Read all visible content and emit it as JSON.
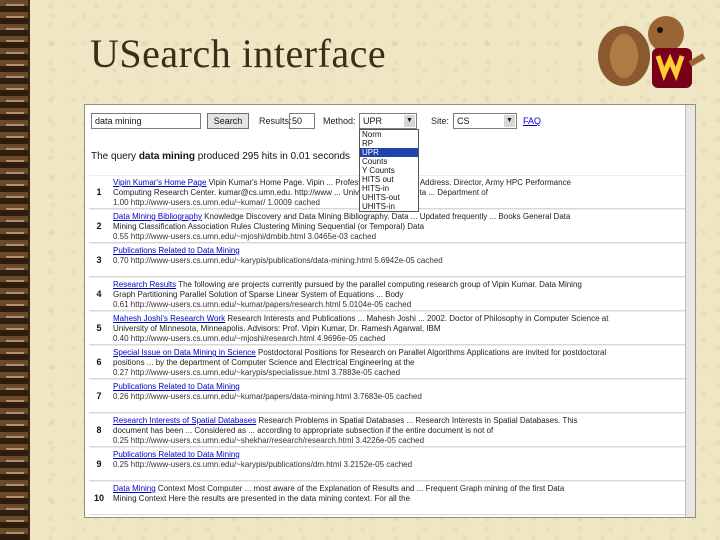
{
  "slide": {
    "title": "USearch interface"
  },
  "search": {
    "query": "data mining",
    "button": "Search",
    "results_label": "Results:",
    "results_value": "50",
    "method_label": "Method:",
    "method_value": "UPR",
    "method_options": [
      "Norm",
      "RP",
      "UPR",
      "Counts",
      "Y Counts",
      "HITS out",
      "HITS-in",
      "UHITS-out",
      "UHITS-in"
    ],
    "site_label": "Site:",
    "site_value": "CS",
    "faq": "FAQ"
  },
  "summary": {
    "prefix": "The query",
    "query": "data mining",
    "suffix": "produced 295 hits in 0.01 seconds"
  },
  "results": [
    {
      "num": "1",
      "title": "Vipin Kumar's Home Page",
      "snippet": "Vipin Kumar's Home Page. Vipin ... Professor ... Affiliation's Address. Director, Army HPC Performance",
      "snippet2": "Computing Research Center. kumar@cs.umn.edu. http://www ... University of Minnesota ... Department of",
      "meta": "1.00 http://www-users.cs.umn.edu/~kumar/ 1.0009 cached"
    },
    {
      "num": "2",
      "title": "Data Mining Bibliography",
      "snippet": "Knowledge Discovery and Data Mining Bibliography. Data ... Updated frequently ... Books General Data",
      "snippet2": "Mining Classification Association Rules Clustering Mining Sequential (or Temporal) Data",
      "meta": "0.55 http://www-users.cs.umn.edu/~mjoshi/dmbib.html 3.0465e-03 cached"
    },
    {
      "num": "3",
      "title": "Publications Related to Data Mining",
      "snippet": "",
      "snippet2": "",
      "meta": "0.70 http://www-users.cs.umn.edu/~karypis/publications/data-mining.html 5.6942e-05 cached"
    },
    {
      "num": "4",
      "title": "Research Results",
      "snippet": "The following are projects currently pursued by the parallel computing research group of Vipin Kumar. Data Mining",
      "snippet2": "Graph Partitioning Parallel Solution of Sparse Linear System of Equations ... Body",
      "meta": "0.61 http://www-users.cs.umn.edu/~kumar/papers/research.html 5.0104e-05 cached"
    },
    {
      "num": "5",
      "title": "Mahesh Joshi's Research Work",
      "snippet": "Research Interests and Publications ... Mahesh Joshi ... 2002. Doctor of Philosophy in Computer Science at",
      "snippet2": "University of Minnesota, Minneapolis. Advisors: Prof. Vipin Kumar, Dr. Ramesh Agarwal, IBM",
      "meta": "0.40 http://www-users.cs.umn.edu/~mjoshi/research.html 4.9696e-05 cached"
    },
    {
      "num": "6",
      "title": "Special Issue on Data Mining in Science",
      "snippet": "Postdoctoral Positions for Research on Parallel Algorithms Applications are invited for postdoctoral",
      "snippet2": "positions ... by the department of Computer Science and Electrical Engineering at the",
      "meta": "0.27 http://www-users.cs.umn.edu/~karypis/specialissue.html 3.7883e-05 cached"
    },
    {
      "num": "7",
      "title": "Publications Related to Data Mining",
      "snippet": "",
      "snippet2": "",
      "meta": "0.26 http://www-users.cs.umn.edu/~kumar/papers/data-mining.html 3.7683e-05 cached"
    },
    {
      "num": "8",
      "title": "Research Interests of Spatial Databases",
      "snippet": "Research Problems in Spatial Databases ... Research Interests in Spatial Databases. This",
      "snippet2": "document has been ... Considered as ... according to appropriate subsection if the entire document is not of",
      "meta": "0.25 http://www-users.cs.umn.edu/~shekhar/research/research.html 3.4226e-05 cached"
    },
    {
      "num": "9",
      "title": "Publications Related to Data Mining",
      "snippet": "",
      "snippet2": "",
      "meta": "0.25 http://www-users.cs.umn.edu/~karypis/publications/dm.html 3.2152e-05 cached"
    },
    {
      "num": "10",
      "title": "Data Mining",
      "snippet": "Context Most Computer ... most aware of the Explanation of Results and ... Frequent Graph mining of the first Data",
      "snippet2": "Mining Context Here the results are presented in the data mining context. For all the",
      "meta": ""
    }
  ]
}
